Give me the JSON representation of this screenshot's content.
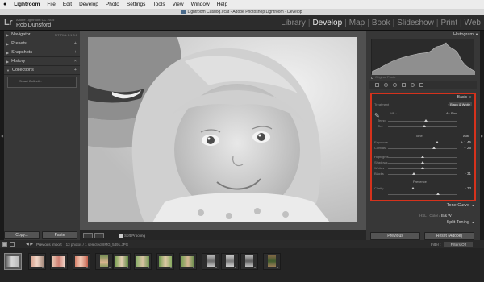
{
  "menubar": {
    "apple": "",
    "items": [
      "Lightroom",
      "File",
      "Edit",
      "Develop",
      "Photo",
      "Settings",
      "Tools",
      "View",
      "Window",
      "Help"
    ]
  },
  "window": {
    "title": "Lightroom Catalog.lrcat - Adobe Photoshop Lightroom - Develop"
  },
  "identity": {
    "logo": "Lr",
    "product": "Adobe Lightroom CC 2015",
    "user": "Rob Dunsford"
  },
  "modules": [
    "Library",
    "Develop",
    "Map",
    "Book",
    "Slideshow",
    "Print",
    "Web"
  ],
  "active_module": "Develop",
  "left_panel": {
    "navigator": "Navigator",
    "navigator_zoom": "FIT  FILL  1:1  3:1",
    "presets": "Presets",
    "snapshots": "Snapshots",
    "history": "History",
    "collections": "Collections",
    "collection_item": "Smart Collecti...",
    "copy_btn": "Copy...",
    "paste_btn": "Paste"
  },
  "toolbar": {
    "soft_proofing": "Soft Proofing"
  },
  "right_panel": {
    "histogram": "Histogram",
    "original_photo": "Original Photo",
    "basic": "Basic",
    "treatment": "Treatment :",
    "color": "Color",
    "black_white": "Black & White",
    "wb": "WB :",
    "as_shot": "As Shot",
    "temp": "Temp",
    "tint": "Tint",
    "tone": "Tone",
    "auto": "Auto",
    "exposure": "Exposure",
    "exposure_val": "+ 1.45",
    "contrast": "Contrast",
    "contrast_val": "+ 26",
    "highlights": "Highlights",
    "shadows": "Shadows",
    "whites": "Whites",
    "blacks": "Blacks",
    "blacks_val": "- 31",
    "presence": "Presence",
    "clarity": "Clarity",
    "clarity_val": "- 33",
    "tone_curve": "Tone Curve",
    "hsl": "HSL",
    "color2": "Color",
    "bw": "B & W",
    "split_toning": "Split Toning",
    "previous_btn": "Previous",
    "reset_btn": "Reset (Adobe)"
  },
  "filmstrip": {
    "previous_import": "Previous Import",
    "count": "13 photos / 1 selected /IMG_5491.JPG",
    "filter_label": "Filter :",
    "filter_value": "Filters Off"
  }
}
